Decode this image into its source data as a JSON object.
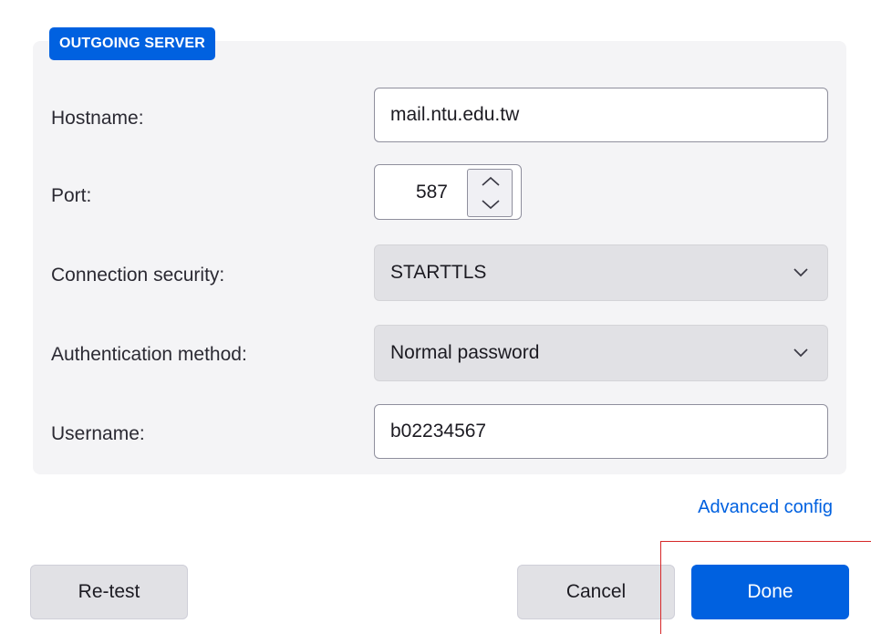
{
  "section": {
    "title": "OUTGOING SERVER"
  },
  "fields": {
    "hostname": {
      "label": "Hostname:",
      "value": "mail.ntu.edu.tw"
    },
    "port": {
      "label": "Port:",
      "value": "587"
    },
    "connection_security": {
      "label": "Connection security:",
      "value": "STARTTLS"
    },
    "auth_method": {
      "label": "Authentication method:",
      "value": "Normal password"
    },
    "username": {
      "label": "Username:",
      "value": "b02234567"
    }
  },
  "links": {
    "advanced_config": "Advanced config"
  },
  "buttons": {
    "retest": "Re-test",
    "cancel": "Cancel",
    "done": "Done"
  },
  "colors": {
    "accent": "#0061e0",
    "panel": "#f4f4f6",
    "marker": "#d62728"
  },
  "icons": [
    "chevron-up-icon",
    "chevron-down-icon"
  ]
}
